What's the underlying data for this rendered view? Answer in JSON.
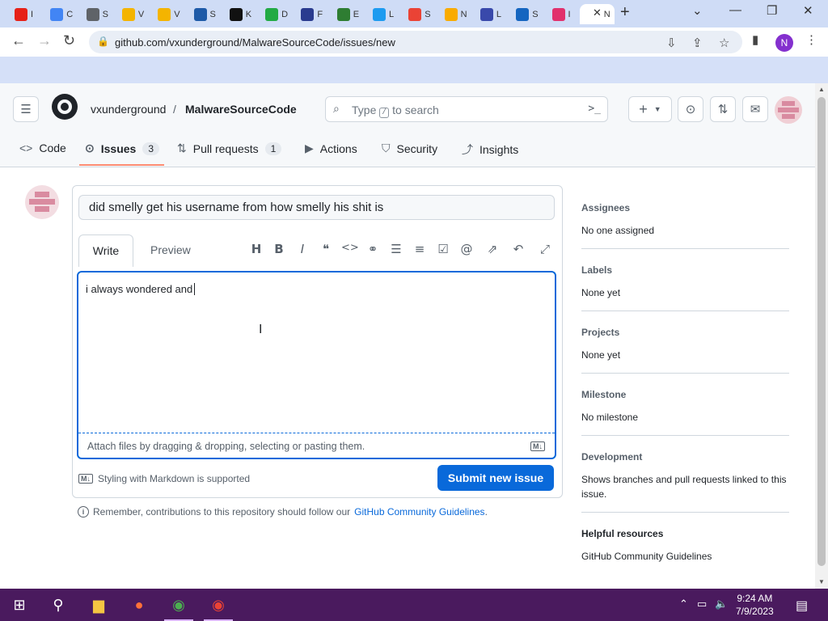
{
  "browser": {
    "tabs": [
      {
        "abbr": "I",
        "color": "#e62117"
      },
      {
        "abbr": "C",
        "color": "#4285f4"
      },
      {
        "abbr": "S",
        "color": "#5f6368"
      },
      {
        "abbr": "V",
        "color": "#f4b400"
      },
      {
        "abbr": "V",
        "color": "#f4b400"
      },
      {
        "abbr": "S",
        "color": "#1e5aa8"
      },
      {
        "abbr": "K",
        "color": "#111111"
      },
      {
        "abbr": "D",
        "color": "#22aa44"
      },
      {
        "abbr": "F",
        "color": "#2a3b8f"
      },
      {
        "abbr": "E",
        "color": "#2e7d32"
      },
      {
        "abbr": "L",
        "color": "#1d9bf0"
      },
      {
        "abbr": "S",
        "color": "#ea4335"
      },
      {
        "abbr": "N",
        "color": "#f9ab00"
      },
      {
        "abbr": "L",
        "color": "#3949ab"
      },
      {
        "abbr": "S",
        "color": "#1565c0"
      },
      {
        "abbr": "I",
        "color": "#e1306c"
      },
      {
        "abbr": "N",
        "color": "#ffffff"
      }
    ],
    "url": "github.com/vxunderground/MalwareSourceCode/issues/new",
    "profile_initial": "N"
  },
  "header": {
    "owner": "vxunderground",
    "separator": "/",
    "repo": "MalwareSourceCode",
    "search_placeholder_pre": "Type",
    "search_key": "/",
    "search_placeholder_post": "to search",
    "plus_label": "+"
  },
  "repo_nav": {
    "code": "Code",
    "issues": "Issues",
    "issues_count": "3",
    "pulls": "Pull requests",
    "pulls_count": "1",
    "actions": "Actions",
    "security": "Security",
    "insights": "Insights"
  },
  "issue_form": {
    "title_value": "did smelly get his username from how smelly his shit is",
    "write_tab": "Write",
    "preview_tab": "Preview",
    "body_value": "i always wondered and",
    "attach_hint": "Attach files by dragging & dropping, selecting or pasting them.",
    "markdown_note": "Styling with Markdown is supported",
    "submit_label": "Submit new issue",
    "guidelines_text": "Remember, contributions to this repository should follow our",
    "guidelines_link": "GitHub Community Guidelines",
    "guidelines_end": ".",
    "accent": "#0969da"
  },
  "sidebar": {
    "assignees_h": "Assignees",
    "assignees_v": "No one assigned",
    "labels_h": "Labels",
    "labels_v": "None yet",
    "projects_h": "Projects",
    "projects_v": "None yet",
    "milestone_h": "Milestone",
    "milestone_v": "No milestone",
    "development_h": "Development",
    "development_v": "Shows branches and pull requests linked to this issue.",
    "helpful_h": "Helpful resources",
    "helpful_link": "GitHub Community Guidelines"
  },
  "taskbar": {
    "time": "9:24 AM",
    "date": "7/9/2023"
  }
}
